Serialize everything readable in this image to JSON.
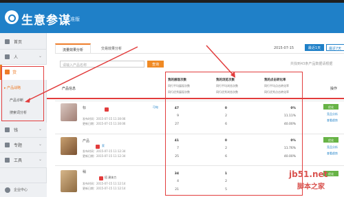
{
  "header": {
    "title": "生意参谋",
    "subtitle": "标准版"
  },
  "sidebar": {
    "items": [
      {
        "label": "首页"
      },
      {
        "label": "人"
      },
      {
        "label": "货"
      }
    ],
    "active_label": "货",
    "sub_items": [
      {
        "label": "产品战略"
      },
      {
        "label": "产品诊断"
      },
      {
        "label": "搜索词分析"
      }
    ],
    "more_items": [
      {
        "label": "钱"
      },
      {
        "label": "专题"
      },
      {
        "label": "工具"
      }
    ],
    "bottom_label": "企业中心"
  },
  "tabs": {
    "active": "流量效果分析",
    "other": "交易效果分析"
  },
  "date_range": {
    "date": "2015-07-15",
    "day_button": "最近1天",
    "week_button": "最近7天"
  },
  "search": {
    "placeholder": "请输入产品名称",
    "button": "查询",
    "count_note": "共找到43条产品数据请根据"
  },
  "table": {
    "product_header": "产品信息",
    "op_header": "操作",
    "metrics": [
      {
        "title": "我的展现次数",
        "sub1": "同行平均展现次数",
        "sub2": "同行优秀展现次数"
      },
      {
        "title": "我的浏览次数",
        "sub1": "同行平均浏览次数",
        "sub2": "同行优秀浏览次数"
      },
      {
        "title": "我的点击转化率",
        "sub1": "同行平均点击转化率",
        "sub2": "同行优秀点击转化率"
      }
    ],
    "rows": [
      {
        "name": "标",
        "tag_text": "可电",
        "pub_text": "发布时间：2015-07-15 11:30:06",
        "upd_text": "更新日期：2015-07-15 11:30:06",
        "impressions": [
          "47",
          "9",
          "27"
        ],
        "views": [
          "0",
          "2",
          "6"
        ],
        "ctr": [
          "0%",
          "11.11%",
          "40.00%"
        ],
        "actions": [
          "优化",
          "竞品分析",
          "查看趋势"
        ]
      },
      {
        "name": "产品",
        "tag_text": "家",
        "pub_text": "发布时间：2015-07-15 11:12:34",
        "upd_text": "更新日期：2015-07-15 11:12:34",
        "impressions": [
          "41",
          "7",
          "25"
        ],
        "views": [
          "0",
          "2",
          "6"
        ],
        "ctr": [
          "0%",
          "11.76%",
          "40.00%"
        ],
        "actions": [
          "优化",
          "竞品分析",
          "查看趋势"
        ]
      },
      {
        "name": "稍",
        "tag_text": "搭 建体力",
        "pub_text": "发布时间：2015-07-15 11:12:14",
        "upd_text": "更新日期：2015-07-15 11:12:14",
        "impressions": [
          "34",
          "4",
          "21"
        ],
        "views": [
          "1",
          "2",
          "5"
        ],
        "ctr": [
          "",
          "",
          ""
        ],
        "actions": [
          "优化",
          "",
          ""
        ]
      }
    ]
  },
  "watermark": {
    "site": "jb51.net",
    "brand": "脚本之家"
  }
}
